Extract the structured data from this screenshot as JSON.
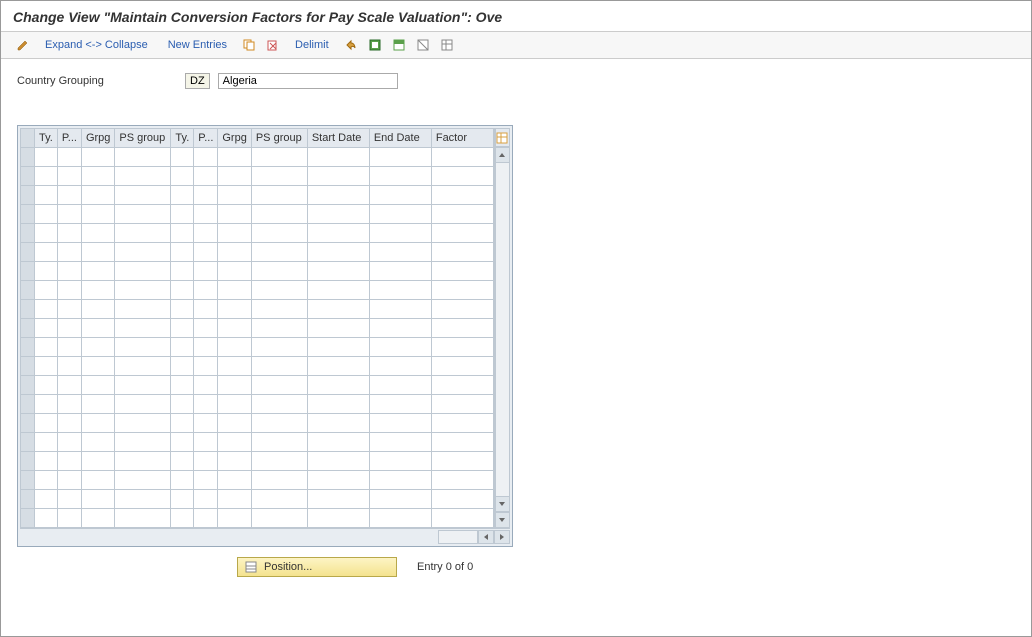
{
  "title": "Change View \"Maintain Conversion Factors for Pay Scale Valuation\": Ove",
  "toolbar": {
    "expand_collapse": "Expand <-> Collapse",
    "new_entries": "New Entries",
    "delimit": "Delimit"
  },
  "country_grouping": {
    "label": "Country Grouping",
    "code": "DZ",
    "name": "Algeria"
  },
  "grid": {
    "columns": [
      "Ty.",
      "P...",
      "Grpg",
      "PS group",
      "Ty.",
      "P...",
      "Grpg",
      "PS group",
      "Start Date",
      "End Date",
      "Factor"
    ],
    "rows": [
      {
        "ty1": "",
        "p1": "",
        "grpg1": "",
        "psg1": "",
        "ty2": "",
        "p2": "",
        "grpg2": "",
        "psg2": "",
        "start": "",
        "end": "",
        "factor": ""
      },
      {
        "ty1": "",
        "p1": "",
        "grpg1": "",
        "psg1": "",
        "ty2": "",
        "p2": "",
        "grpg2": "",
        "psg2": "",
        "start": "",
        "end": "",
        "factor": ""
      },
      {
        "ty1": "",
        "p1": "",
        "grpg1": "",
        "psg1": "",
        "ty2": "",
        "p2": "",
        "grpg2": "",
        "psg2": "",
        "start": "",
        "end": "",
        "factor": ""
      },
      {
        "ty1": "",
        "p1": "",
        "grpg1": "",
        "psg1": "",
        "ty2": "",
        "p2": "",
        "grpg2": "",
        "psg2": "",
        "start": "",
        "end": "",
        "factor": ""
      },
      {
        "ty1": "",
        "p1": "",
        "grpg1": "",
        "psg1": "",
        "ty2": "",
        "p2": "",
        "grpg2": "",
        "psg2": "",
        "start": "",
        "end": "",
        "factor": ""
      },
      {
        "ty1": "",
        "p1": "",
        "grpg1": "",
        "psg1": "",
        "ty2": "",
        "p2": "",
        "grpg2": "",
        "psg2": "",
        "start": "",
        "end": "",
        "factor": ""
      },
      {
        "ty1": "",
        "p1": "",
        "grpg1": "",
        "psg1": "",
        "ty2": "",
        "p2": "",
        "grpg2": "",
        "psg2": "",
        "start": "",
        "end": "",
        "factor": ""
      },
      {
        "ty1": "",
        "p1": "",
        "grpg1": "",
        "psg1": "",
        "ty2": "",
        "p2": "",
        "grpg2": "",
        "psg2": "",
        "start": "",
        "end": "",
        "factor": ""
      },
      {
        "ty1": "",
        "p1": "",
        "grpg1": "",
        "psg1": "",
        "ty2": "",
        "p2": "",
        "grpg2": "",
        "psg2": "",
        "start": "",
        "end": "",
        "factor": ""
      },
      {
        "ty1": "",
        "p1": "",
        "grpg1": "",
        "psg1": "",
        "ty2": "",
        "p2": "",
        "grpg2": "",
        "psg2": "",
        "start": "",
        "end": "",
        "factor": ""
      },
      {
        "ty1": "",
        "p1": "",
        "grpg1": "",
        "psg1": "",
        "ty2": "",
        "p2": "",
        "grpg2": "",
        "psg2": "",
        "start": "",
        "end": "",
        "factor": ""
      },
      {
        "ty1": "",
        "p1": "",
        "grpg1": "",
        "psg1": "",
        "ty2": "",
        "p2": "",
        "grpg2": "",
        "psg2": "",
        "start": "",
        "end": "",
        "factor": ""
      },
      {
        "ty1": "",
        "p1": "",
        "grpg1": "",
        "psg1": "",
        "ty2": "",
        "p2": "",
        "grpg2": "",
        "psg2": "",
        "start": "",
        "end": "",
        "factor": ""
      },
      {
        "ty1": "",
        "p1": "",
        "grpg1": "",
        "psg1": "",
        "ty2": "",
        "p2": "",
        "grpg2": "",
        "psg2": "",
        "start": "",
        "end": "",
        "factor": ""
      },
      {
        "ty1": "",
        "p1": "",
        "grpg1": "",
        "psg1": "",
        "ty2": "",
        "p2": "",
        "grpg2": "",
        "psg2": "",
        "start": "",
        "end": "",
        "factor": ""
      },
      {
        "ty1": "",
        "p1": "",
        "grpg1": "",
        "psg1": "",
        "ty2": "",
        "p2": "",
        "grpg2": "",
        "psg2": "",
        "start": "",
        "end": "",
        "factor": ""
      },
      {
        "ty1": "",
        "p1": "",
        "grpg1": "",
        "psg1": "",
        "ty2": "",
        "p2": "",
        "grpg2": "",
        "psg2": "",
        "start": "",
        "end": "",
        "factor": ""
      },
      {
        "ty1": "",
        "p1": "",
        "grpg1": "",
        "psg1": "",
        "ty2": "",
        "p2": "",
        "grpg2": "",
        "psg2": "",
        "start": "",
        "end": "",
        "factor": ""
      },
      {
        "ty1": "",
        "p1": "",
        "grpg1": "",
        "psg1": "",
        "ty2": "",
        "p2": "",
        "grpg2": "",
        "psg2": "",
        "start": "",
        "end": "",
        "factor": ""
      },
      {
        "ty1": "",
        "p1": "",
        "grpg1": "",
        "psg1": "",
        "ty2": "",
        "p2": "",
        "grpg2": "",
        "psg2": "",
        "start": "",
        "end": "",
        "factor": ""
      }
    ]
  },
  "footer": {
    "position_btn": "Position...",
    "entry_text": "Entry 0 of 0"
  }
}
